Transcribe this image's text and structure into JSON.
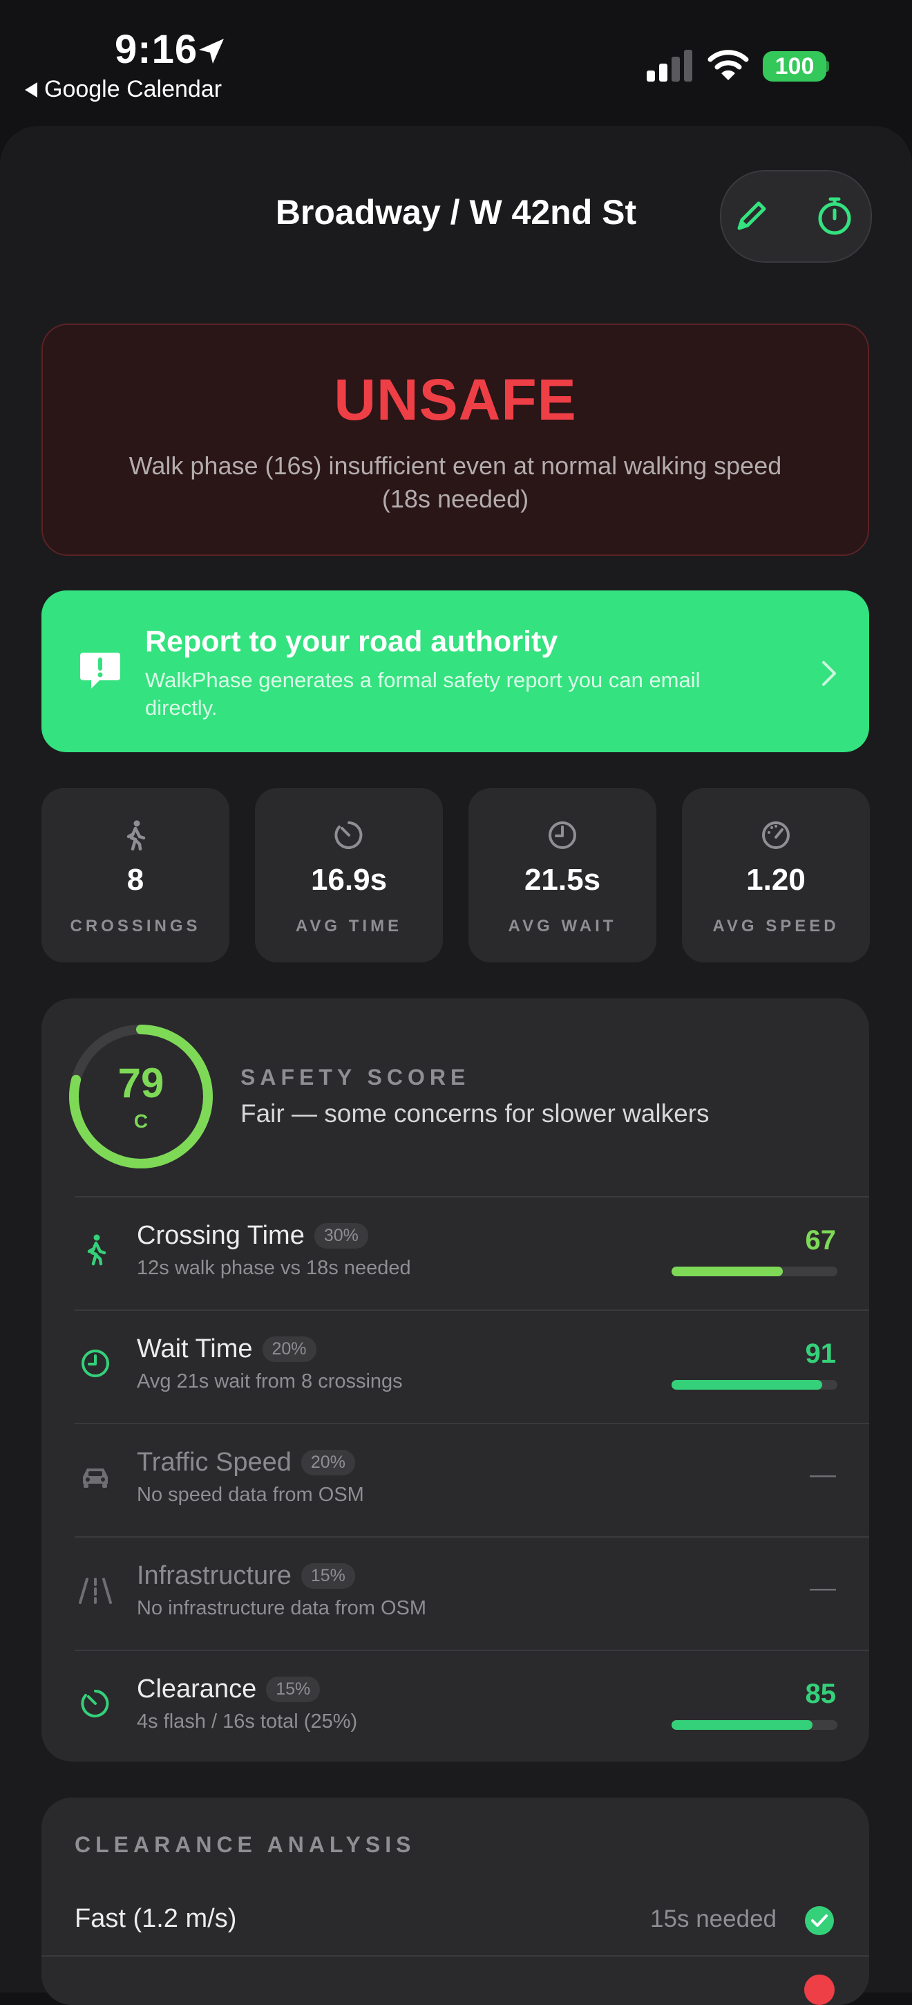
{
  "status_bar": {
    "time": "9:16",
    "back_label": "Google Calendar",
    "battery": "100"
  },
  "header": {
    "title": "Broadway / W 42nd St"
  },
  "verdict": {
    "title": "UNSAFE",
    "description": "Walk phase (16s) insufficient even at normal walking speed (18s needed)",
    "color": "#ef3f46"
  },
  "report": {
    "title": "Report to your road authority",
    "description": "WalkPhase generates a formal safety report you can email directly.",
    "color": "#34e27f"
  },
  "stats": [
    {
      "icon": "pedestrian-icon",
      "value": "8",
      "label": "CROSSINGS"
    },
    {
      "icon": "timer-icon",
      "value": "16.9s",
      "label": "AVG TIME"
    },
    {
      "icon": "clock-icon",
      "value": "21.5s",
      "label": "AVG WAIT"
    },
    {
      "icon": "speedometer-icon",
      "value": "1.20",
      "label": "AVG SPEED"
    }
  ],
  "safety": {
    "score": "79",
    "grade": "C",
    "score_fraction": 0.79,
    "label": "SAFETY SCORE",
    "description": "Fair — some concerns for slower walkers",
    "rows": [
      {
        "icon": "walking-icon",
        "title": "Crossing Time",
        "weight": "30%",
        "subtitle": "12s walk phase vs 18s needed",
        "score": "67",
        "fraction": 0.67,
        "color": "#7ed957"
      },
      {
        "icon": "clock-icon",
        "title": "Wait Time",
        "weight": "20%",
        "subtitle": "Avg 21s wait from 8 crossings",
        "score": "91",
        "fraction": 0.91,
        "color": "#34d17a"
      },
      {
        "icon": "car-icon",
        "title": "Traffic Speed",
        "weight": "20%",
        "subtitle": "No speed data from OSM",
        "score": "—",
        "fraction": null,
        "color": "#6e6e73"
      },
      {
        "icon": "road-icon",
        "title": "Infrastructure",
        "weight": "15%",
        "subtitle": "No infrastructure data from OSM",
        "score": "—",
        "fraction": null,
        "color": "#6e6e73"
      },
      {
        "icon": "timer-icon",
        "title": "Clearance",
        "weight": "15%",
        "subtitle": "4s flash / 16s total (25%)",
        "score": "85",
        "fraction": 0.85,
        "color": "#34d17a"
      }
    ]
  },
  "clearance": {
    "label": "CLEARANCE ANALYSIS",
    "rows": [
      {
        "label": "Fast (1.2 m/s)",
        "needed": "15s needed",
        "status": "pass"
      }
    ]
  }
}
